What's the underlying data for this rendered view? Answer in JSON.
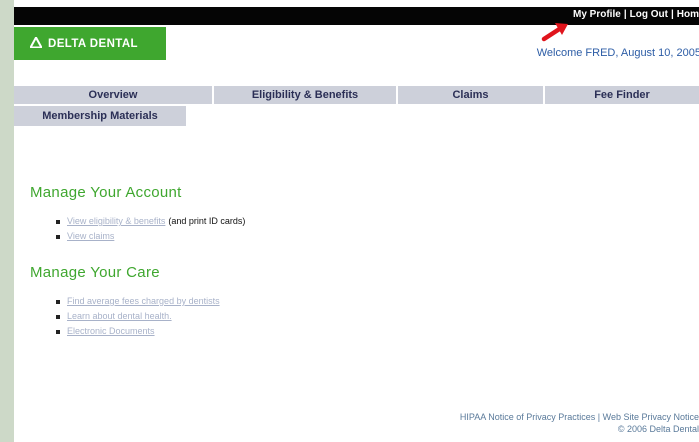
{
  "header": {
    "top_links": [
      "My Profile",
      "Log Out",
      "Hom"
    ],
    "separator": "|",
    "logo_text": "DELTA DENTAL",
    "welcome": "Welcome FRED, August 10, 2005"
  },
  "nav": {
    "tabs": [
      "Overview",
      "Eligibility & Benefits",
      "Claims",
      "Fee Finder"
    ],
    "secondary": "Membership Materials"
  },
  "account": {
    "title": "Manage Your Account",
    "items": [
      {
        "link": "View eligibility & benefits",
        "suffix": "(and print ID cards)"
      },
      {
        "link": "View claims",
        "suffix": ""
      }
    ]
  },
  "care": {
    "title": "Manage Your Care",
    "items": [
      {
        "link": "Find average fees charged by dentists"
      },
      {
        "link": "Learn about dental health."
      },
      {
        "link": "Electronic Documents"
      }
    ]
  },
  "footer": {
    "hipaa": "HIPAA Notice of Privacy Practices",
    "privacy": "Web Site Privacy Notice",
    "separator": "|",
    "copyright": "© 2006 Delta Dental"
  },
  "colors": {
    "brand_green": "#3fa72f",
    "nav_bg": "#cdd0da",
    "link": "#a8b2c9",
    "welcome": "#2d5da6"
  }
}
